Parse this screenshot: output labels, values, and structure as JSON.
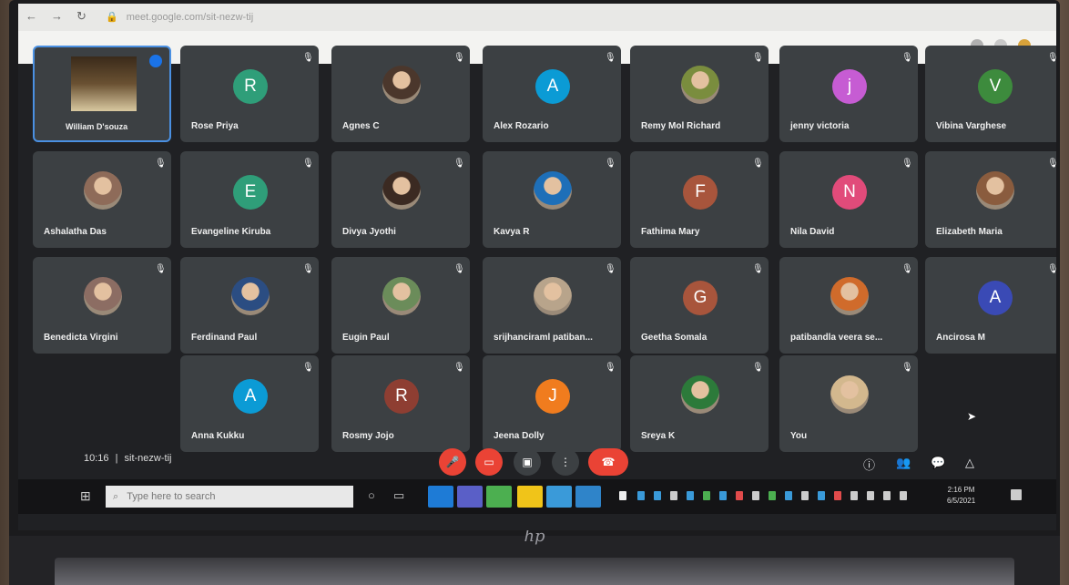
{
  "browser": {
    "url": "meet.google.com/sit-nezw-tij"
  },
  "participants": [
    {
      "name": "William D'souza",
      "type": "photo",
      "color": "#6a5132"
    },
    {
      "name": "Rose Priya",
      "type": "initial",
      "initial": "R",
      "color": "#2f9e79"
    },
    {
      "name": "Agnes C",
      "type": "photo",
      "color": "#4b372c"
    },
    {
      "name": "Alex Rozario",
      "type": "initial",
      "initial": "A",
      "color": "#0b9bd5"
    },
    {
      "name": "Remy Mol Richard",
      "type": "photo",
      "color": "#7a8d3e"
    },
    {
      "name": "jenny victoria",
      "type": "initial",
      "initial": "j",
      "color": "#c65cd3"
    },
    {
      "name": "Vibina Varghese",
      "type": "initial",
      "initial": "V",
      "color": "#3d8b3d"
    },
    {
      "name": "Ashalatha Das",
      "type": "photo",
      "color": "#8e6b59"
    },
    {
      "name": "Evangeline Kiruba",
      "type": "initial",
      "initial": "E",
      "color": "#2f9e79"
    },
    {
      "name": "Divya Jyothi",
      "type": "photo",
      "color": "#3b2a22"
    },
    {
      "name": "Kavya R",
      "type": "photo",
      "color": "#1e6fb8"
    },
    {
      "name": "Fathima Mary",
      "type": "initial",
      "initial": "F",
      "color": "#a8553c"
    },
    {
      "name": "Nila David",
      "type": "initial",
      "initial": "N",
      "color": "#e14b7a"
    },
    {
      "name": "Elizabeth Maria",
      "type": "photo",
      "color": "#8a5c3e"
    },
    {
      "name": "Benedicta Virgini",
      "type": "photo",
      "color": "#8c6d63"
    },
    {
      "name": "Ferdinand Paul",
      "type": "photo",
      "color": "#2b4d82"
    },
    {
      "name": "Eugin Paul",
      "type": "photo",
      "color": "#6b8c5a"
    },
    {
      "name": "srijhanciraml patiban...",
      "type": "photo",
      "color": "#b8a48b"
    },
    {
      "name": "Geetha Somala",
      "type": "initial",
      "initial": "G",
      "color": "#a8553c"
    },
    {
      "name": "patibandla veera se...",
      "type": "photo",
      "color": "#d06b2b"
    },
    {
      "name": "Ancirosa M",
      "type": "initial",
      "initial": "A",
      "color": "#3a4ab5"
    },
    {
      "name": "Anna Kukku",
      "type": "initial",
      "initial": "A",
      "color": "#0b9bd5"
    },
    {
      "name": "Rosmy Jojo",
      "type": "initial",
      "initial": "R",
      "color": "#8e3e32"
    },
    {
      "name": "Jeena Dolly",
      "type": "initial",
      "initial": "J",
      "color": "#f07c1e"
    },
    {
      "name": "Sreya K",
      "type": "photo",
      "color": "#2c7a3a"
    },
    {
      "name": "You",
      "type": "photo",
      "color": "#d3b88e"
    }
  ],
  "footer": {
    "time": "10:16",
    "separator": "|",
    "meeting_code": "sit-nezw-tij"
  },
  "taskbar": {
    "search_placeholder": "Type here to search",
    "clock_time": "2:16 PM",
    "clock_date": "6/5/2021"
  },
  "icons": {
    "mute": "microphone-off-icon"
  }
}
